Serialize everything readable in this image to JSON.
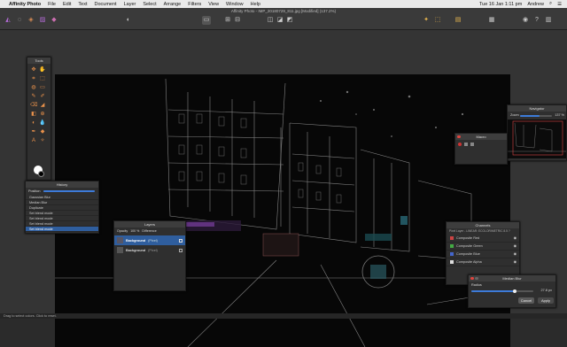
{
  "menubar": {
    "app_name": "Affinity Photo",
    "items": [
      "File",
      "Edit",
      "Text",
      "Document",
      "Layer",
      "Select",
      "Arrange",
      "Filters",
      "View",
      "Window",
      "Help"
    ],
    "clock": "Tue 16 Jan  1:11 pm",
    "user": "Andrew"
  },
  "toolbar": {
    "document_title": "Affinity Photo - IMP_20180729_811.jpg [Modified] (137.2%)"
  },
  "tools_panel": {
    "title": "Tools"
  },
  "history_panel": {
    "title": "History",
    "position_label": "Position",
    "items": [
      "Gaussian Blur",
      "Median Blur",
      "Duplicate",
      "Set blend mode",
      "Set blend mode",
      "Set blend mode",
      "Set blend mode"
    ]
  },
  "layers_panel": {
    "title": "Layers",
    "opacity_label": "Opacity",
    "opacity_value": "100 %",
    "blend_mode": "Difference",
    "layers": [
      {
        "name": "Background",
        "type": "(Pixel)"
      },
      {
        "name": "Background",
        "type": "(Pixel)"
      }
    ]
  },
  "navigator_panel": {
    "title": "Navigator",
    "zoom_label": "Zoom",
    "zoom_value": "137 %"
  },
  "macro_panel": {
    "title": "Macro"
  },
  "channels_panel": {
    "title": "Channels",
    "subtitle": "Pixel Layer - LINEAR: ECOLORIMETRIC 8.5 ?",
    "items": [
      "Composite Red",
      "Composite Green",
      "Composite Blue",
      "Composite Alpha"
    ]
  },
  "median_blur_dialog": {
    "title": "Median Blur",
    "radius_label": "Radius",
    "radius_value": "27.8 px",
    "cancel_label": "Cancel",
    "apply_label": "Apply"
  },
  "statusbar": {
    "text": "Drag to select colors. Click to reset."
  },
  "colors": {
    "accent": "#3d7bd9",
    "tool_orange": "#e8914b",
    "selection_blue": "#2f5e9e"
  }
}
